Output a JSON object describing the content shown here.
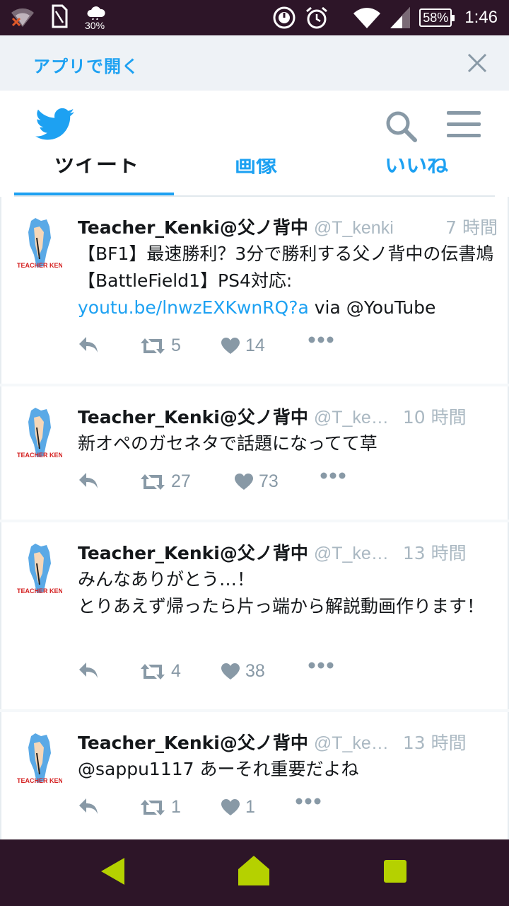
{
  "status_bar": {
    "weather_percent": "30%",
    "battery": "58%",
    "time": "1:46",
    "icons": [
      "wifi-off-icon",
      "sim-card-icon",
      "cloud-icon",
      "data-saver-icon",
      "alarm-icon",
      "wifi-icon",
      "signal-icon",
      "battery-icon"
    ]
  },
  "banner": {
    "open_in_app": "アプリで開く",
    "close_icon": "close-icon"
  },
  "header": {
    "logo": "twitter-bird-logo",
    "search_icon": "search-icon",
    "menu_icon": "hamburger-menu-icon"
  },
  "tabs": [
    {
      "label": "ツイート",
      "active": true
    },
    {
      "label": "画像",
      "active": false
    },
    {
      "label": "いいね",
      "active": false
    }
  ],
  "tweets": [
    {
      "name": "Teacher_Kenki@父ノ背中",
      "handle": "@T_kenki",
      "time": "7 時間",
      "text": "【BF1】最速勝利？3分で勝利する父ノ背中の伝書鳩【BattleField1】PS4対応: ",
      "link": "youtu.be/lnwzEXKwnRQ?a",
      "text_after": " via @YouTube",
      "retweets": "5",
      "likes": "14"
    },
    {
      "name": "Teacher_Kenki@父ノ背中",
      "handle": "@T_kenki",
      "time": "10 時間",
      "text": "新オペのガセネタで話題になってて草",
      "link": "",
      "text_after": "",
      "retweets": "27",
      "likes": "73"
    },
    {
      "name": "Teacher_Kenki@父ノ背中",
      "handle": "@T_kenki",
      "time": "13 時間",
      "text": "みんなありがとう…！\nとりあえず帰ったら片っ端から解説動画作ります！",
      "link": "",
      "text_after": "",
      "retweets": "4",
      "likes": "38"
    },
    {
      "name": "Teacher_Kenki@父ノ背中",
      "handle": "@T_kenki",
      "time": "13 時間",
      "text": "@sappu1117 あーそれ重要だよね",
      "link": "",
      "text_after": "",
      "retweets": "1",
      "likes": "1"
    }
  ],
  "colors": {
    "twitter_blue": "#1da1f2",
    "muted": "#aab8c2",
    "system_bar": "#2d1528",
    "nav_button": "#b5d100"
  }
}
